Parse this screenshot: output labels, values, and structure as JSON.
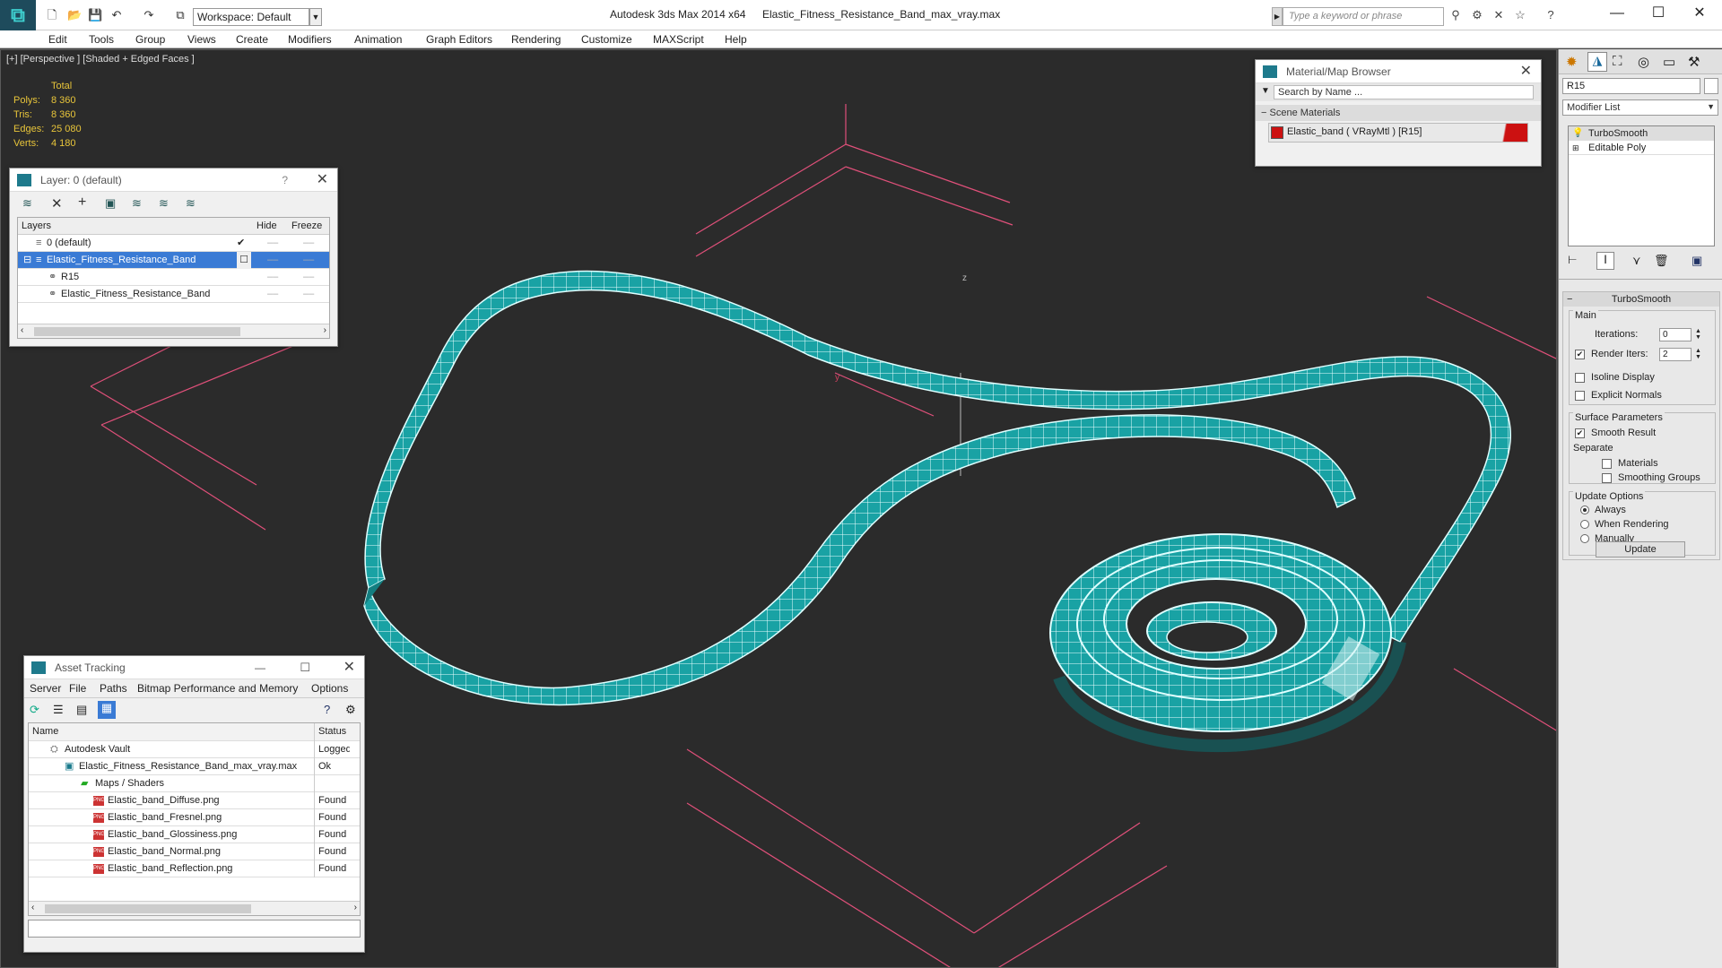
{
  "app": {
    "title": "Autodesk 3ds Max  2014 x64",
    "file": "Elastic_Fitness_Resistance_Band_max_vray.max",
    "workspace": "Workspace: Default",
    "search_placeholder": "Type a keyword or phrase"
  },
  "menu": [
    "Edit",
    "Tools",
    "Group",
    "Views",
    "Create",
    "Modifiers",
    "Animation",
    "Graph Editors",
    "Rendering",
    "Customize",
    "MAXScript",
    "Help"
  ],
  "viewport": {
    "label": "[+] [Perspective ] [Shaded + Edged Faces ]",
    "stats": {
      "header": "Total",
      "rows": [
        {
          "label": "Polys:",
          "value": "8 360"
        },
        {
          "label": "Tris:",
          "value": "8 360"
        },
        {
          "label": "Edges:",
          "value": "25 080"
        },
        {
          "label": "Verts:",
          "value": "4 180"
        }
      ]
    },
    "axis_z": "z",
    "axis_y": "y"
  },
  "layer_panel": {
    "title": "Layer: 0 (default)",
    "help": "?",
    "columns": {
      "layers": "Layers",
      "hide": "Hide",
      "freeze": "Freeze"
    },
    "rows": [
      {
        "name": "0 (default)"
      },
      {
        "name": "Elastic_Fitness_Resistance_Band"
      },
      {
        "name": "R15"
      },
      {
        "name": "Elastic_Fitness_Resistance_Band"
      }
    ]
  },
  "material_browser": {
    "title": "Material/Map Browser",
    "search_placeholder": "Search by Name ...",
    "section": "Scene Materials",
    "item": "Elastic_band  ( VRayMtl )  [R15]",
    "swatch_color": "#cc1111"
  },
  "asset_tracking": {
    "title": "Asset Tracking",
    "menu": [
      "Server",
      "File",
      "Paths",
      "Bitmap Performance and Memory",
      "Options"
    ],
    "columns": {
      "name": "Name",
      "status": "Status"
    },
    "rows": [
      {
        "name": "Autodesk Vault",
        "status": "Logged O"
      },
      {
        "name": "Elastic_Fitness_Resistance_Band_max_vray.max",
        "status": "Ok"
      },
      {
        "name": "Maps / Shaders",
        "status": ""
      },
      {
        "name": "Elastic_band_Diffuse.png",
        "status": "Found"
      },
      {
        "name": "Elastic_band_Fresnel.png",
        "status": "Found"
      },
      {
        "name": "Elastic_band_Glossiness.png",
        "status": "Found"
      },
      {
        "name": "Elastic_band_Normal.png",
        "status": "Found"
      },
      {
        "name": "Elastic_band_Reflection.png",
        "status": "Found"
      }
    ]
  },
  "command_panel": {
    "object_name": "R15",
    "modifier_list": "Modifier List",
    "stack": [
      "TurboSmooth",
      "Editable Poly"
    ],
    "rollout_title": "TurboSmooth",
    "main_label": "Main",
    "iterations_label": "Iterations:",
    "iterations_value": "0",
    "render_iters_label": "Render Iters:",
    "render_iters_value": "2",
    "isoline": "Isoline Display",
    "explicit_normals": "Explicit Normals",
    "surface_params": "Surface Parameters",
    "smooth_result": "Smooth Result",
    "separate": "Separate",
    "materials": "Materials",
    "smoothing_groups": "Smoothing Groups",
    "update_options": "Update Options",
    "always": "Always",
    "when_rendering": "When Rendering",
    "manually": "Manually",
    "update_button": "Update"
  },
  "colors": {
    "band": "#1aa5a5",
    "viewport_bg": "#2b2b2b",
    "grid_pink": "#e0507a",
    "stats": "#e8c53a",
    "selection": "#3a7bd5"
  }
}
